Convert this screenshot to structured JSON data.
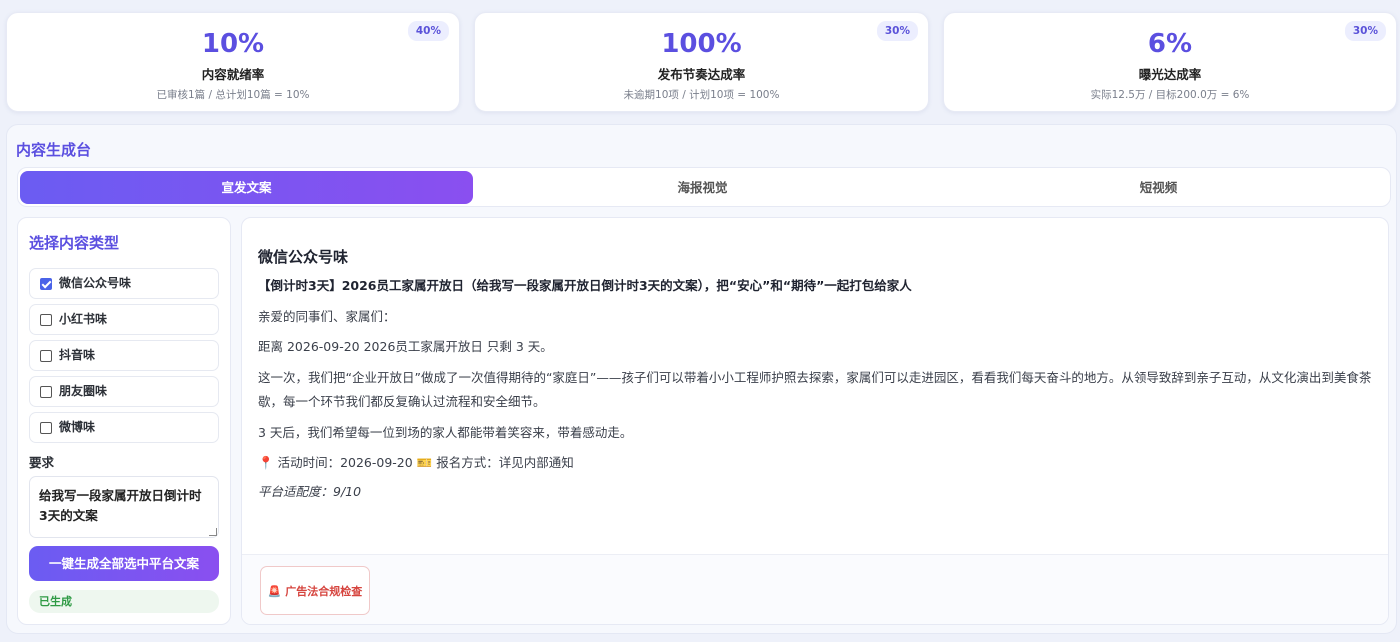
{
  "kpis": [
    {
      "value": "10%",
      "label": "内容就绪率",
      "sub": "已审核1篇 / 总计划10篇 = 10%",
      "weight": "40%"
    },
    {
      "value": "100%",
      "label": "发布节奏达成率",
      "sub": "未逾期10项 / 计划10项 = 100%",
      "weight": "30%"
    },
    {
      "value": "6%",
      "label": "曝光达成率",
      "sub": "实际12.5万 / 目标200.0万 = 6%",
      "weight": "30%"
    }
  ],
  "panel": {
    "title": "内容生成台",
    "tabs": [
      "宣发文案",
      "海报视觉",
      "短视频"
    ],
    "active_tab": "宣发文案"
  },
  "sidebar": {
    "title": "选择内容类型",
    "options": [
      {
        "label": "微信公众号味",
        "checked": true
      },
      {
        "label": "小红书味",
        "checked": false
      },
      {
        "label": "抖音味",
        "checked": false
      },
      {
        "label": "朋友圈味",
        "checked": false
      },
      {
        "label": "微博味",
        "checked": false
      }
    ],
    "requirement_label": "要求",
    "requirement_value": "给我写一段家属开放日倒计时3天的文案",
    "generate_button": "一键生成全部选中平台文案",
    "status": "已生成"
  },
  "content": {
    "platform_title": "微信公众号味",
    "headline": "【倒计时3天】2026员工家属开放日（给我写一段家属开放日倒计时3天的文案），把“安心”和“期待”一起打包给家人",
    "greeting": "亲爱的同事们、家属们：",
    "countdown": "距离 2026-09-20 2026员工家属开放日 只剩 3 天。",
    "body": "这一次，我们把“企业开放日”做成了一次值得期待的“家庭日”——孩子们可以带着小小工程师护照去探索，家属们可以走进园区，看看我们每天奋斗的地方。从领导致辞到亲子互动，从文化演出到美食茶歇，每一个环节我们都反复确认过流程和安全细节。",
    "closing": "3 天后，我们希望每一位到场的家人都能带着笑容来，带着感动走。",
    "event_time": "活动时间：2026-09-20",
    "signup": "报名方式：详见内部通知",
    "fit_score": "平台适配度：9/10",
    "compliance_button": "广告法合规检查"
  },
  "colors": {
    "accent": "#5b4fe0",
    "gradient_start": "#6b5cf2",
    "gradient_end": "#8a4ff0",
    "success": "#2e9a44",
    "danger": "#d6453f"
  }
}
